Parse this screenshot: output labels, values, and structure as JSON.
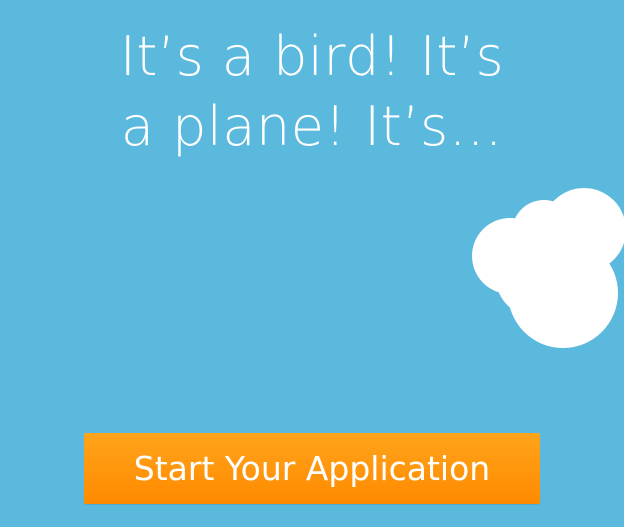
{
  "hero": {
    "headline_line1": "It’s a bird! It’s",
    "headline_line2": "a plane! It’s…"
  },
  "cta": {
    "label": "Start Your Application"
  },
  "colors": {
    "background": "#5bb9dd",
    "button": "#ff9800",
    "text": "#ffffff",
    "cloud": "#ffffff"
  },
  "icons": {
    "cloud": "cloud-icon"
  }
}
